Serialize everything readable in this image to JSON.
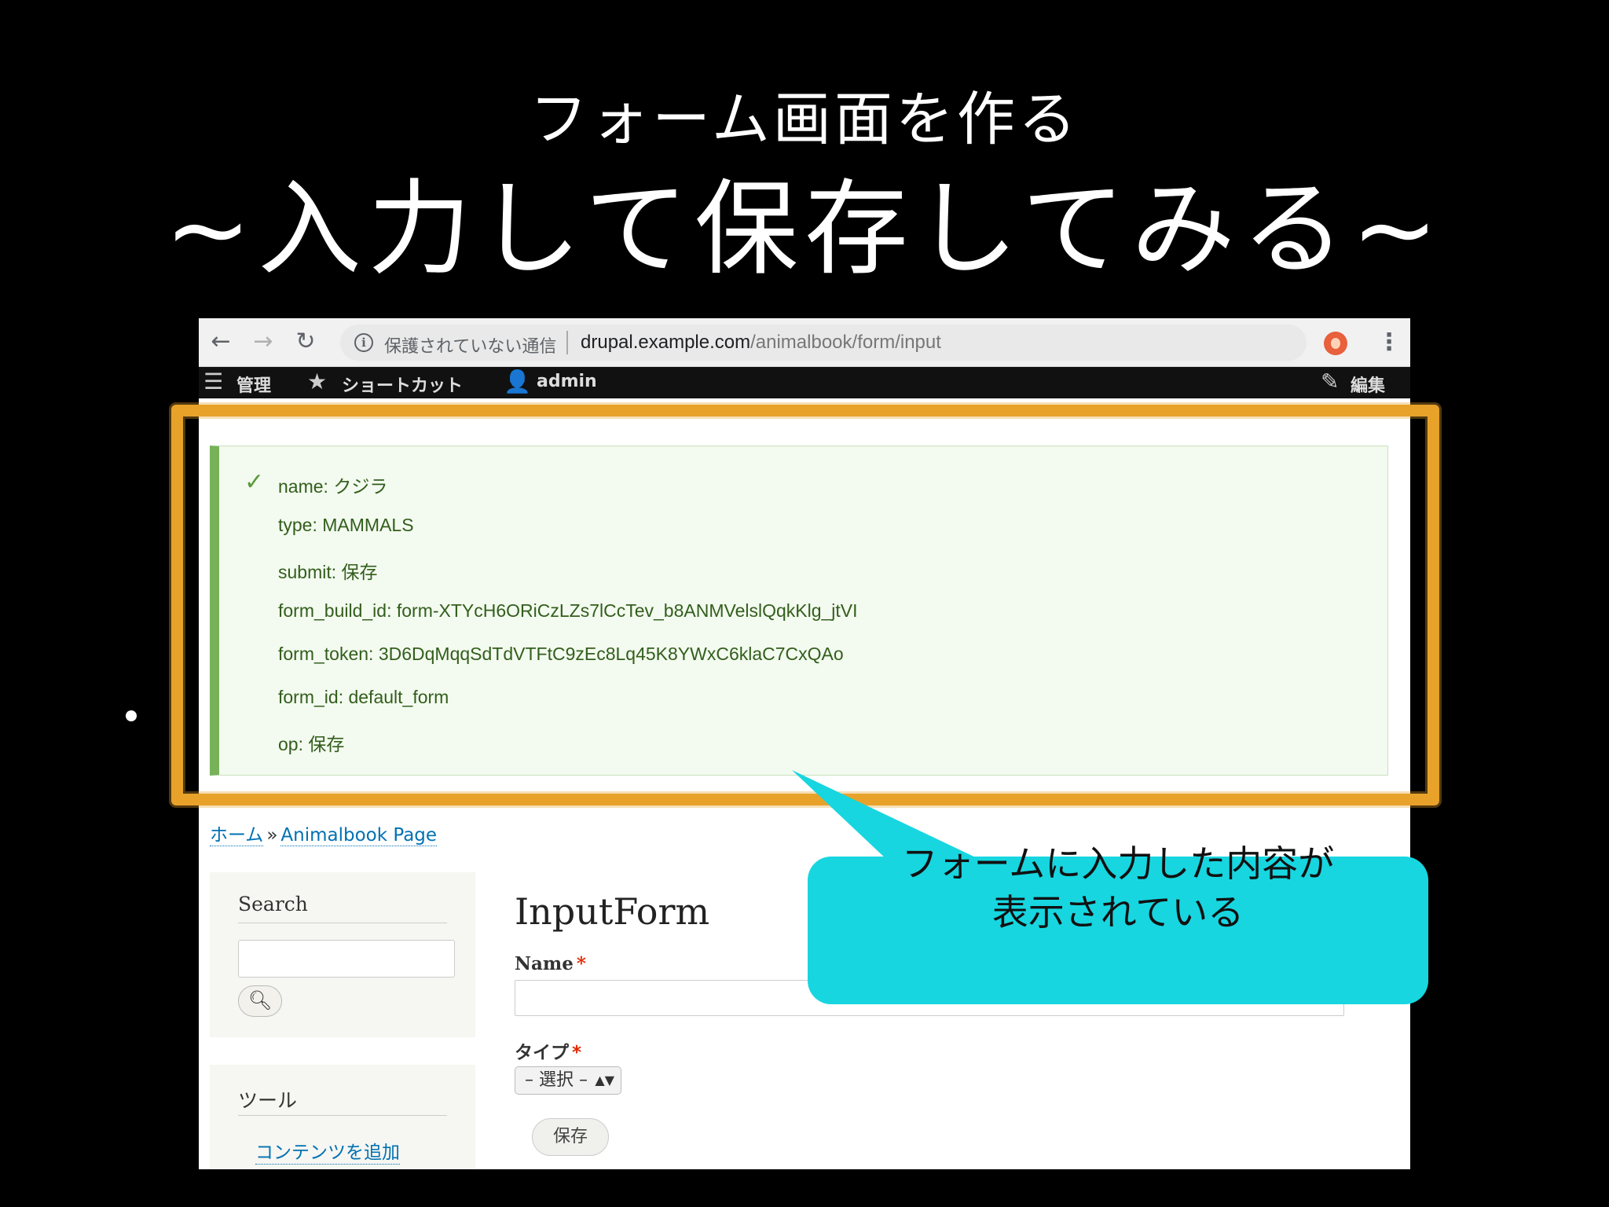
{
  "slide": {
    "title_line1": "フォーム画面を作る",
    "title_line2": "~入力して保存してみる~"
  },
  "browser": {
    "back_icon": "back-arrow-icon",
    "forward_icon": "forward-arrow-icon",
    "reload_icon": "reload-icon",
    "security_text": "保護されていない通信",
    "url_host": "drupal.example.com",
    "url_path": "/animalbook/form/input"
  },
  "toolbar": {
    "manage_label": "管理",
    "shortcuts_label": "ショートカット",
    "user_label": "admin",
    "edit_label": "編集"
  },
  "status_message": {
    "lines": [
      "name: クジラ",
      "type: MAMMALS",
      "submit: 保存",
      "form_build_id: form-XTYcH6ORiCzLZs7lCcTev_b8ANMVelslQqkKlg_jtVI",
      "form_token: 3D6DqMqqSdTdVTFtC9zEc8Lq45K8YWxC6klaC7CxQAo",
      "form_id: default_form",
      "op: 保存"
    ]
  },
  "breadcrumb": {
    "home": "ホーム",
    "separator": "»",
    "current": "Animalbook Page"
  },
  "sidebar": {
    "search_title": "Search",
    "tools_title": "ツール",
    "tools_link": "コンテンツを追加"
  },
  "form": {
    "title": "InputForm",
    "name_label": "Name",
    "required_mark": "*",
    "type_label": "タイプ",
    "type_selected": "– 選択 –",
    "save_button": "保存"
  },
  "callout": {
    "line1": "フォームに入力した内容が",
    "line2": "表示されている"
  },
  "colors": {
    "highlight": "#e8a22a",
    "callout": "#17d6e0",
    "status_border": "#77b259",
    "link": "#0071b3"
  }
}
